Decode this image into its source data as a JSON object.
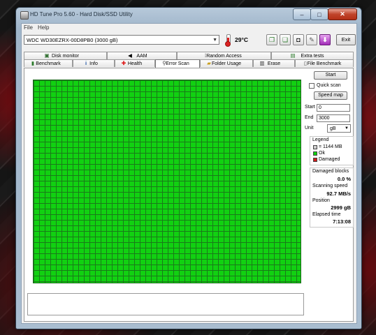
{
  "window": {
    "title": "HD Tune Pro 5.60 - Hard Disk/SSD Utility",
    "minimize_glyph": "–",
    "maximize_glyph": "□",
    "close_glyph": "✕"
  },
  "menu": {
    "file": "File",
    "help": "Help"
  },
  "toolbar": {
    "drive": "WDC WD30EZRX-00D8PB0 (3000 gB)",
    "temperature": "29°C",
    "exit_label": "Exit"
  },
  "tabs_top": [
    {
      "label": "Disk monitor",
      "icon": "disk-monitor-icon"
    },
    {
      "label": "AAM",
      "icon": "speaker-icon"
    },
    {
      "label": "Random Access",
      "icon": "random-access-icon"
    },
    {
      "label": "Extra tests",
      "icon": "extra-tests-icon"
    }
  ],
  "tabs_bottom": [
    {
      "label": "Benchmark",
      "icon": "benchmark-icon"
    },
    {
      "label": "Info",
      "icon": "info-icon"
    },
    {
      "label": "Health",
      "icon": "health-icon"
    },
    {
      "label": "Error Scan",
      "icon": "error-scan-icon",
      "active": true
    },
    {
      "label": "Folder Usage",
      "icon": "folder-icon"
    },
    {
      "label": "Erase",
      "icon": "trash-icon"
    },
    {
      "label": "File Benchmark",
      "icon": "file-benchmark-icon"
    }
  ],
  "scan": {
    "start_button": "Start",
    "quick_scan_label": "Quick scan",
    "speed_map_button": "Speed map",
    "start_label": "Start",
    "start_value": "0",
    "end_label": "End",
    "end_value": "3000",
    "unit_label": "Unit",
    "unit_value": "gB"
  },
  "legend": {
    "title": "Legend",
    "block_size": "= 1144 MB",
    "ok": "Ok",
    "damaged": "Damaged",
    "ok_color": "#11d111",
    "damaged_color": "#d31b1b"
  },
  "stats": {
    "damaged_blocks_label": "Damaged blocks",
    "damaged_blocks_value": "0.0 %",
    "scanning_speed_label": "Scanning speed",
    "scanning_speed_value": "92.7 MB/s",
    "position_label": "Position",
    "position_value": "2999 gB",
    "elapsed_label": "Elapsed time",
    "elapsed_value": "7:13:08"
  }
}
